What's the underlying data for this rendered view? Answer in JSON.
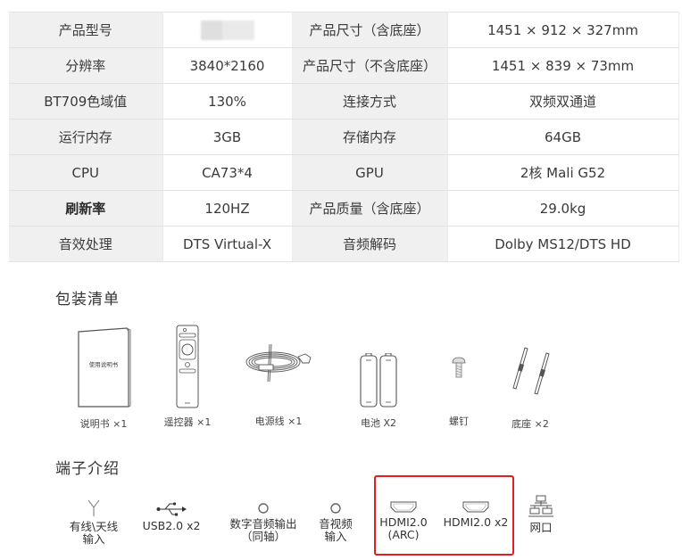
{
  "spec_table": {
    "rows": [
      {
        "k1": "产品型号",
        "v1": "",
        "v1_blurred": true,
        "k2": "产品尺寸（含底座）",
        "v2": "1451 × 912 × 327mm"
      },
      {
        "k1": "分辨率",
        "v1": "3840*2160",
        "k2": "产品尺寸（不含底座）",
        "v2": "1451 × 839 × 73mm"
      },
      {
        "k1": "BT709色域值",
        "v1": "130%",
        "k2": "连接方式",
        "v2": "双频双通道"
      },
      {
        "k1": "运行内存",
        "v1": "3GB",
        "k2": "存储内存",
        "v2": "64GB"
      },
      {
        "k1": "CPU",
        "v1": "CA73*4",
        "k2": "GPU",
        "v2": "2核 Mali G52"
      },
      {
        "k1": "刷新率",
        "k1_bold": true,
        "v1": "120HZ",
        "k2": "产品质量（含底座）",
        "v2": "29.0kg"
      },
      {
        "k1": "音效处理",
        "v1": "DTS Virtual-X",
        "k2": "音频解码",
        "v2": "Dolby MS12/DTS HD"
      }
    ]
  },
  "package": {
    "title": "包装清单",
    "items": [
      {
        "icon": "manual-icon",
        "label": "说明书 ×1",
        "manual_cover_text": "使用说明书"
      },
      {
        "icon": "remote-control-icon",
        "label": "遥控器 ×1"
      },
      {
        "icon": "power-cable-icon",
        "label": "电源线 ×1"
      },
      {
        "icon": "batteries-icon",
        "label": "电池 X2"
      },
      {
        "icon": "screw-icon",
        "label": "螺钉"
      },
      {
        "icon": "stand-legs-icon",
        "label": "底座 ×2"
      }
    ]
  },
  "ports": {
    "title": "端子介绍",
    "items": [
      {
        "icon": "antenna-icon",
        "label": "有线\\天线\n输入"
      },
      {
        "icon": "usb-icon",
        "label": "USB2.0 x2"
      },
      {
        "icon": "coaxial-port-icon",
        "label": "数字音频输出\n（同轴）"
      },
      {
        "icon": "av-port-icon",
        "label": "音视频\n输入"
      },
      {
        "icon": "hdmi-icon",
        "label": "HDMI2.0\n(ARC)"
      },
      {
        "icon": "hdmi-icon",
        "label": "HDMI2.0 x2"
      },
      {
        "icon": "ethernet-icon",
        "label": "网口"
      }
    ],
    "highlight_color": "#e02020"
  }
}
